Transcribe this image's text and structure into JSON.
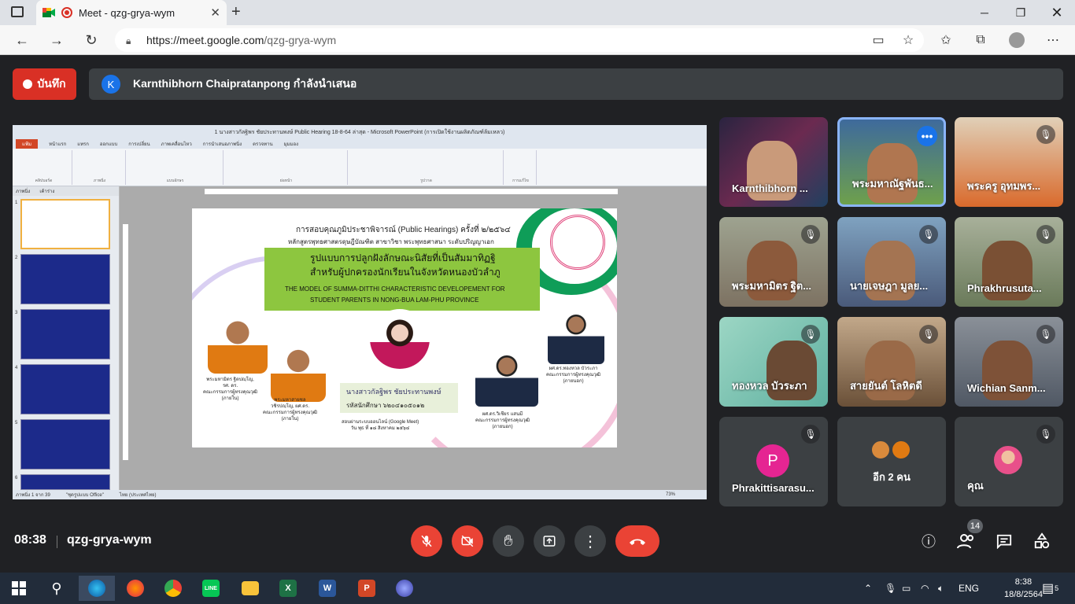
{
  "browser": {
    "tab_title": "Meet - qzg-grya-wym",
    "url_host": "https://meet.google.com",
    "url_path": "/qzg-grya-wym"
  },
  "meet": {
    "record_label": "บันทึก",
    "presenter_initial": "K",
    "presenting_text": "Karnthibhorn Chaipratanpong กำลังนำเสนอ",
    "time": "08:38",
    "meeting_code": "qzg-grya-wym",
    "participant_count": "14",
    "colors": {
      "record_red": "#d93025",
      "accent_blue": "#1a73e8",
      "hangup_red": "#ea4335"
    }
  },
  "powerpoint": {
    "window_title": "1 นางสาวกัลฐิพร ชัยประทานพงษ์  Public Hearing 18-8-64 ล่าสุด - Microsoft PowerPoint (การเปิดใช้งานผลิตภัณฑ์ล้มเหลว)",
    "tabs": [
      "แฟ้ม",
      "หน้าแรก",
      "แทรก",
      "ออกแบบ",
      "การเปลี่ยน",
      "ภาพเคลื่อนไหว",
      "การนำเสนอภาพนิ่ง",
      "ตรวจทาน",
      "มุมมอง"
    ],
    "ribbon_groups": [
      "คลิปบอร์ด",
      "ภาพนิ่ง",
      "แบบอักษร",
      "ย่อหน้า",
      "รูปวาด",
      "การแก้ไข"
    ],
    "panel_tabs": [
      "ภาพนิ่ง",
      "เค้าร่าง"
    ],
    "slide_numbers": [
      "1",
      "2",
      "3",
      "4",
      "5",
      "6"
    ],
    "status": [
      "ภาพนิ่ง 1 จาก 39",
      "\"ชุดรูปแบบ Office\"",
      "ไทย (ประเทศไทย)"
    ],
    "zoom": "73%"
  },
  "slide": {
    "heading1": "การสอบคุณภูมิประชาพิจารณ์ (Public Hearings) ครั้งที่ ๒/๒๕๖๔",
    "heading2": "หลักสูตรพุทธศาสตรดุษฎีบัณฑิต  สาขาวิชา พระพุทธศาสนา ระดับปริญญาเอก",
    "thai_title1": "รูปแบบการปลูกฝังลักษณะนิสัยที่เป็นสัมมาทิฏฐิ",
    "thai_title2": "สำหรับผู้ปกครองนักเรียนในจังหวัดหนองบัวลำภู",
    "en_title1": "THE MODEL OF SUMMA-DITTHI CHARACTERISTIC DEVELOPEMENT  FOR",
    "en_title2": "STUDENT PARENTS IN NONG-BUA LAM-PHU PROVINCE",
    "presenter_name": "นางสาวกัลฐิพร ชัยประทานพงษ์",
    "student_id": "รหัสนักศึกษา  ๖๒๐๔๑๐๕๐๑๒",
    "meeting_line1": "สอบผ่านระบบออนไลน์ (Google Meet)",
    "meeting_line2": "วัน พุธ ที่ ๑๘ สิงหาคม ๒๕๖๔",
    "committee": [
      {
        "name": "พระมหามิตร ฐิตปญฺโญ,",
        "line2": "รศ. ดร.",
        "line3": "คณะกรรมการผู้ทรงคุณวุฒิ",
        "line4": "(ภายใน)"
      },
      {
        "name": "พระมหาสายชล",
        "line2": "วชิรปญฺโญ, ผศ.ดร.",
        "line3": "คณะกรรมการผู้ทรงคุณวุฒิ",
        "line4": "(ภายใน)"
      },
      {
        "name": "ผศ.ดร.วิเชียร แสนมี",
        "line2": "คณะกรรมการผู้ทรงคุณวุฒิ",
        "line3": "(ภายนอก)"
      },
      {
        "name": "ผศ.ดร.ทองหวล บัวระภา",
        "line2": "คณะกรรมการผู้ทรงคุณวุฒิ",
        "line3": "(ภายนอก)"
      }
    ]
  },
  "participants": [
    {
      "name": "Karnthibhorn ...",
      "muted": false,
      "active": false,
      "bg": "#2a2440"
    },
    {
      "name": "พระมหาณัฐพันธ...",
      "muted": false,
      "active": true,
      "bg": "#3e6a9c"
    },
    {
      "name": "พระครู อุทมพร...",
      "muted": true,
      "active": false,
      "bg": "#d96a2c"
    },
    {
      "name": "พระมหามิตร ฐิต...",
      "muted": true,
      "active": false,
      "bg": "#8a8f7e"
    },
    {
      "name": "นายเจษฎา มูลย...",
      "muted": true,
      "active": false,
      "bg": "#5f7fa0"
    },
    {
      "name": "Phrakhrusuta...",
      "muted": true,
      "active": false,
      "bg": "#7b8f6a"
    },
    {
      "name": "ทองหวล บัวระภา",
      "muted": true,
      "active": false,
      "bg": "#7cc2b0"
    },
    {
      "name": "สายยันต์ โลหิตดี",
      "muted": true,
      "active": false,
      "bg": "#8a7058"
    },
    {
      "name": "Wichian Sanm...",
      "muted": true,
      "active": false,
      "bg": "#6a7080"
    }
  ],
  "bottom_tiles": {
    "p_tile": {
      "initial": "P",
      "name": "Phrakittisarasu..."
    },
    "more_tile": {
      "label": "อีก 2 คน"
    },
    "self_tile": {
      "name": "คุณ"
    }
  },
  "taskbar": {
    "apps": [
      "start",
      "search",
      "edge",
      "firefox",
      "chrome",
      "line",
      "explorer",
      "excel",
      "word",
      "powerpoint",
      "other"
    ],
    "lang": "ENG",
    "time": "8:38",
    "date": "18/8/2564",
    "notification_count": "5"
  }
}
